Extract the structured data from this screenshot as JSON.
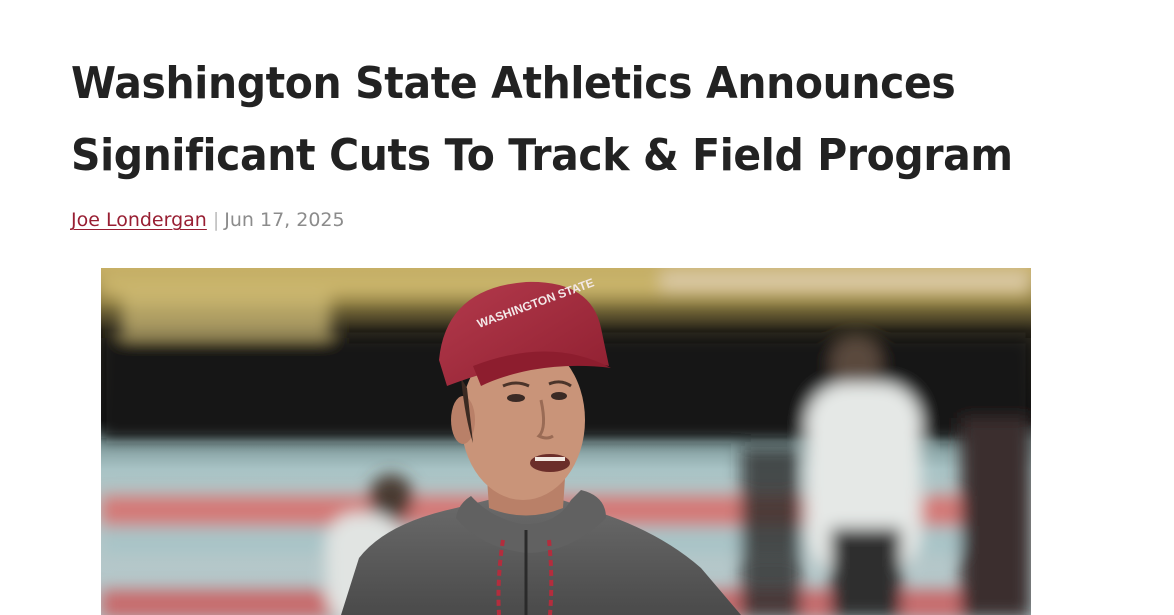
{
  "article": {
    "headline_line1": "Washington State Athletics Announces",
    "headline_line2": "Significant Cuts To Track & Field Program",
    "author": "Joe Londergan",
    "separator": "|",
    "date": "Jun 17, 2025"
  },
  "hero_image": {
    "alt": "Washington State track coach wearing a crimson Washington State cap",
    "cap_text": "WASHINGTON STATE",
    "colors": {
      "cap": "#a8273a",
      "hoodie": "#5a5a5a",
      "skin": "#c89378",
      "track_red": "#d47876",
      "track_blue": "#a6c2c5"
    }
  }
}
